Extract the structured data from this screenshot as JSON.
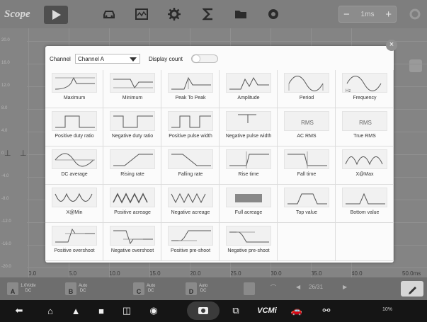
{
  "app": {
    "title": "Scope"
  },
  "toolbar": {
    "timebase": "1ms",
    "minus": "−",
    "plus": "+"
  },
  "plot": {
    "y_labels": [
      "20.0",
      "16.0",
      "12.0",
      "8.0",
      "4.0",
      "0",
      "-4.0",
      "-8.0",
      "-12.0",
      "-16.0",
      "-20.0"
    ],
    "x_labels": [
      "0.0",
      "5.0",
      "10.0",
      "15.0",
      "20.0",
      "25.0",
      "30.0",
      "35.0",
      "40.0"
    ],
    "x_unit": "50.0ms"
  },
  "channels": [
    {
      "tag": "A",
      "range": "1.0V/div",
      "coupling": "DC"
    },
    {
      "tag": "B",
      "range": "Auto",
      "coupling": "DC"
    },
    {
      "tag": "C",
      "range": "Auto",
      "coupling": "DC"
    },
    {
      "tag": "D",
      "range": "Auto",
      "coupling": "DC"
    }
  ],
  "pager": "26/31",
  "dialog": {
    "channel_label": "Channel",
    "channel_value": "Channel A",
    "display_count_label": "Display count",
    "close": "×",
    "measurements": [
      {
        "name": "Maximum",
        "icon": "maximum-icon"
      },
      {
        "name": "Minimum",
        "icon": "minimum-icon"
      },
      {
        "name": "Peak To Peak",
        "icon": "peak-to-peak-icon"
      },
      {
        "name": "Amplitude",
        "icon": "amplitude-icon"
      },
      {
        "name": "Period",
        "icon": "period-icon"
      },
      {
        "name": "Frequency",
        "icon": "frequency-icon"
      },
      {
        "name": "Positive duty ratio",
        "icon": "positive-duty-ratio-icon"
      },
      {
        "name": "Negative duty ratio",
        "icon": "negative-duty-ratio-icon"
      },
      {
        "name": "Positive pulse width",
        "icon": "positive-pulse-width-icon"
      },
      {
        "name": "Negative pulse width",
        "icon": "negative-pulse-width-icon"
      },
      {
        "name": "AC RMS",
        "icon": "ac-rms-icon",
        "icon_text": "RMS"
      },
      {
        "name": "True RMS",
        "icon": "true-rms-icon",
        "icon_text": "RMS"
      },
      {
        "name": "DC average",
        "icon": "dc-average-icon"
      },
      {
        "name": "Rising rate",
        "icon": "rising-rate-icon"
      },
      {
        "name": "Falling rate",
        "icon": "falling-rate-icon"
      },
      {
        "name": "Rise time",
        "icon": "rise-time-icon"
      },
      {
        "name": "Fall time",
        "icon": "fall-time-icon"
      },
      {
        "name": "X@Max",
        "icon": "x-at-max-icon"
      },
      {
        "name": "X@Min",
        "icon": "x-at-min-icon"
      },
      {
        "name": "Positive acreage",
        "icon": "positive-acreage-icon"
      },
      {
        "name": "Negative acreage",
        "icon": "negative-acreage-icon"
      },
      {
        "name": "Full acreage",
        "icon": "full-acreage-icon"
      },
      {
        "name": "Top value",
        "icon": "top-value-icon"
      },
      {
        "name": "Bottom value",
        "icon": "bottom-value-icon"
      },
      {
        "name": "Positive overshoot",
        "icon": "positive-overshoot-icon"
      },
      {
        "name": "Negative overshoot",
        "icon": "negative-overshoot-icon"
      },
      {
        "name": "Positive pre-shoot",
        "icon": "positive-pre-shoot-icon"
      },
      {
        "name": "Negative pre-shoot",
        "icon": "negative-pre-shoot-icon"
      }
    ]
  },
  "navbar": {
    "vcm_label": "VCMi",
    "status": "10%"
  }
}
